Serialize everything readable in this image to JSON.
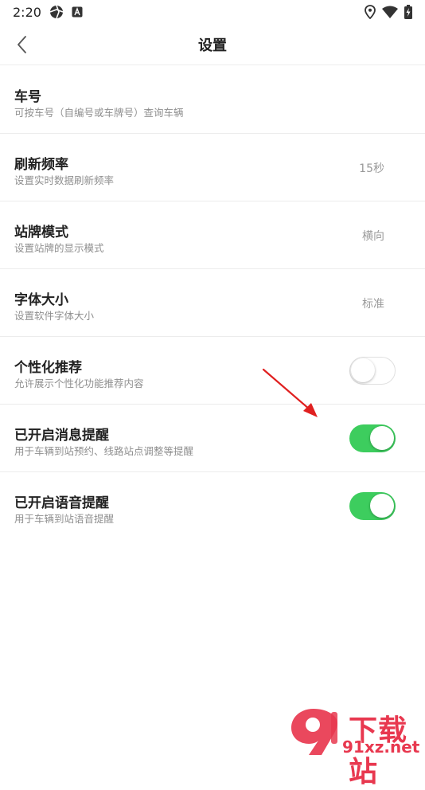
{
  "status_bar": {
    "time": "2:20",
    "icons": [
      "aperture-icon",
      "a-badge-icon",
      "location-icon",
      "wifi-icon",
      "battery-charging-icon"
    ]
  },
  "header": {
    "title": "设置",
    "back_icon": "chevron-left-icon"
  },
  "settings": [
    {
      "title": "车号",
      "desc": "可按车号（自编号或车牌号）查询车辆",
      "value": ""
    },
    {
      "title": "刷新频率",
      "desc": "设置实时数据刷新频率",
      "value": "15秒"
    },
    {
      "title": "站牌模式",
      "desc": "设置站牌的显示模式",
      "value": "横向"
    },
    {
      "title": "字体大小",
      "desc": "设置软件字体大小",
      "value": "标准"
    },
    {
      "title": "个性化推荐",
      "desc": "允许展示个性化功能推荐内容",
      "toggle": false
    },
    {
      "title": "已开启消息提醒",
      "desc": "用于车辆到站预约、线路站点调整等提醒",
      "toggle": true
    },
    {
      "title": "已开启语音提醒",
      "desc": "用于车辆到站语音提醒",
      "toggle": true
    }
  ],
  "colors": {
    "toggle_on": "#3dcd5e",
    "toggle_off_border": "#e0e0e0",
    "annotation_arrow": "#e02020",
    "watermark": "#e8384f"
  },
  "watermark": {
    "top": "下载站",
    "bottom": "91xz.net"
  }
}
